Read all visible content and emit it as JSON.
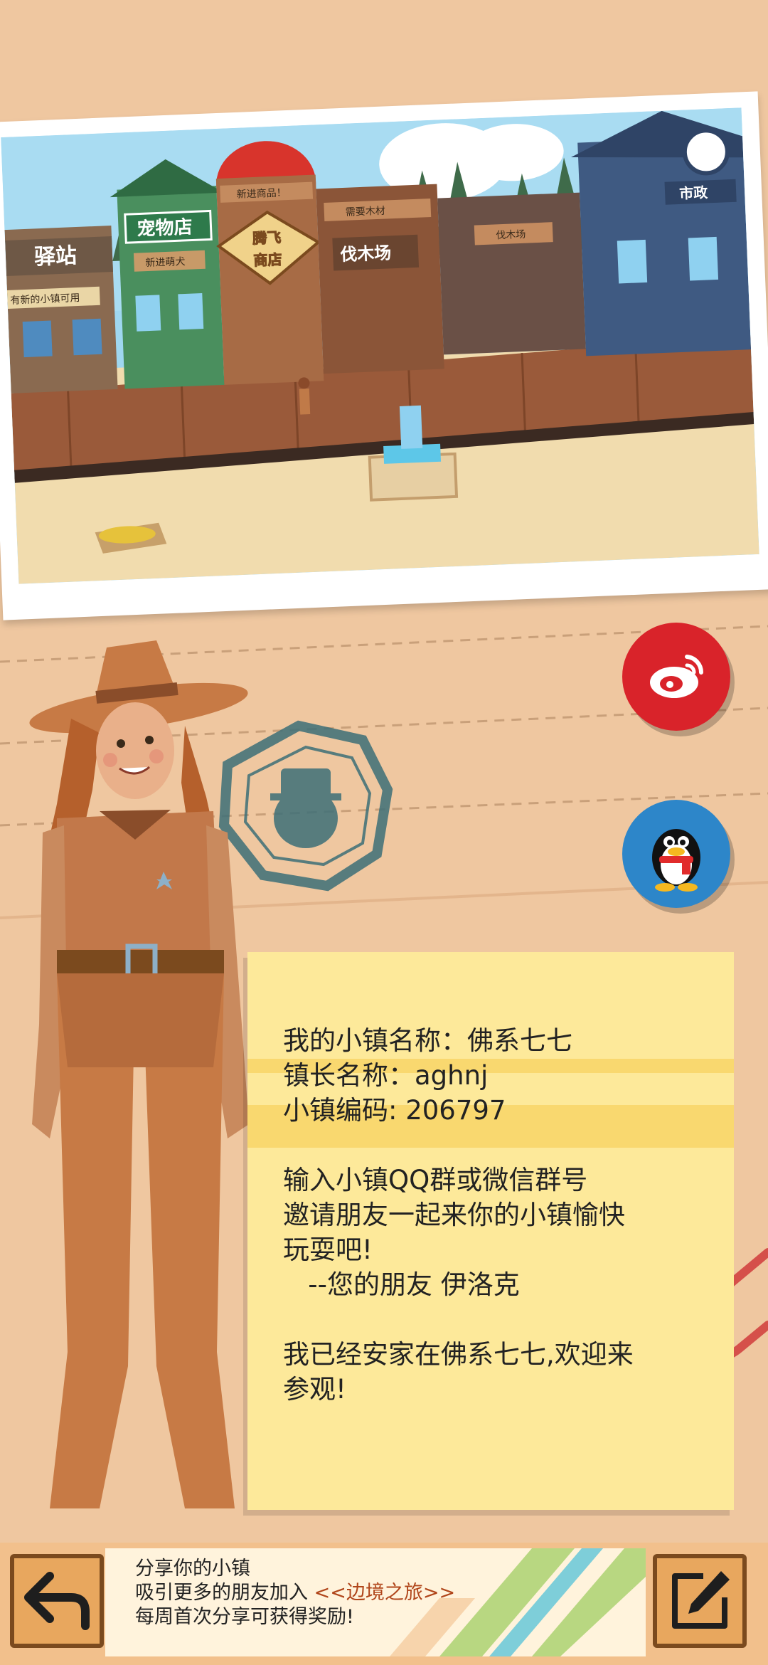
{
  "screenshot": {
    "signs": {
      "inn": "驿站",
      "inn_sub": "有新的小镇可用",
      "pet_shop": "宠物店",
      "pet_shop_sub": "新进萌犬",
      "shop_top": "新进商品！",
      "shop_line1": "腾飞",
      "shop_line2": "商店",
      "lumber_top": "需要木材",
      "lumber": "伐木场",
      "logging_board": "伐木场",
      "town_hall": "市政"
    }
  },
  "share_buttons": {
    "weibo_icon": "weibo-icon",
    "qq_icon": "qq-penguin-icon"
  },
  "note": {
    "town_name_line": "我的小镇名称：佛系七七",
    "mayor_line": "镇长名称：aghnj",
    "code_line": "小镇编码: 206797",
    "invite_line1": "输入小镇QQ群或微信群号",
    "invite_line2": "邀请朋友一起来你的小镇愉快",
    "invite_line3": "玩耍吧!",
    "signature": "   --您的朋友 伊洛克",
    "settled_line1": "我已经安家在佛系七七,欢迎来",
    "settled_line2": "参观!"
  },
  "bottom": {
    "share_title": "分享你的小镇",
    "attract_prefix": "吸引更多的朋友加入 ",
    "game_name": "<<边境之旅>>",
    "weekly_reward": "每周首次分享可获得奖励!",
    "back_icon": "back-arrow-icon",
    "edit_icon": "edit-pen-icon"
  },
  "colors": {
    "background": "#efc7a0",
    "note": "#fde99a",
    "weibo": "#d9232a",
    "qq": "#2d86c9",
    "accent": "#b0451a"
  }
}
